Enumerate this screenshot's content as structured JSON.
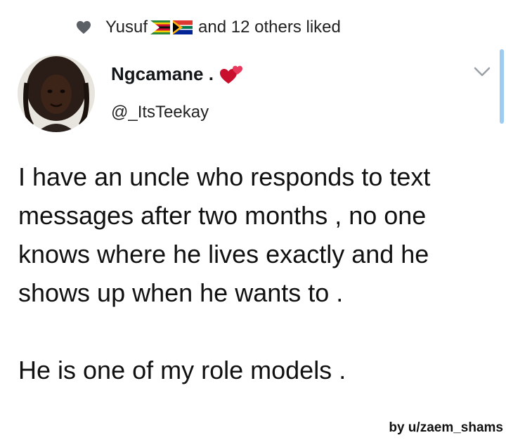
{
  "liked_by": {
    "name": "Yusuf",
    "rest": "and 12 others liked",
    "flags": [
      "zimbabwe-flag",
      "south-africa-flag"
    ]
  },
  "author": {
    "display_name": "Ngcamane .",
    "handle": "@_ItsTeekay"
  },
  "tweet": {
    "paragraph_1": "I have an uncle who responds to text messages after two months , no one knows where he lives exactly and he shows up when he wants to .",
    "paragraph_2": "He is one of my role models ."
  },
  "watermark": "by u/zaem_shams",
  "colors": {
    "text": "#14171a",
    "heart": "#d81b45",
    "scrollbar": "#9ecbf0"
  }
}
